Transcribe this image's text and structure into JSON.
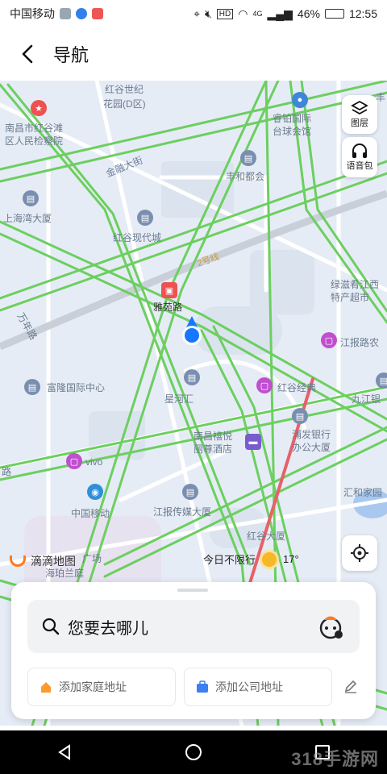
{
  "status_bar": {
    "carrier": "中国移动",
    "battery": "46%",
    "time": "12:55",
    "signal_label": "4G",
    "hd_label": "HD"
  },
  "header": {
    "title": "导航"
  },
  "map": {
    "labels": [
      {
        "text": "红谷世纪"
      },
      {
        "text": "花园(D区)"
      },
      {
        "text": "南昌市红谷滩"
      },
      {
        "text": "区人民检察院"
      },
      {
        "text": "睿铂国际"
      },
      {
        "text": "台球会馆"
      },
      {
        "text": "金融大街"
      },
      {
        "text": "丰和都会"
      },
      {
        "text": "上海湾大厦"
      },
      {
        "text": "红谷现代城"
      },
      {
        "text": "2号线"
      },
      {
        "text": "雅苑路"
      },
      {
        "text": "绿滋肴江西"
      },
      {
        "text": "特产超市"
      },
      {
        "text": "江报路农"
      },
      {
        "text": "万年路"
      },
      {
        "text": "富隆国际中心"
      },
      {
        "text": "星河汇"
      },
      {
        "text": "红谷经典"
      },
      {
        "text": "九江银"
      },
      {
        "text": "浦发银行"
      },
      {
        "text": "办公大厦"
      },
      {
        "text": "南昌禧悦"
      },
      {
        "text": "丽尊酒店"
      },
      {
        "text": "vivo"
      },
      {
        "text": "汇和家园"
      },
      {
        "text": "中国移动"
      },
      {
        "text": "江报传媒大厦"
      },
      {
        "text": "红谷大厦"
      },
      {
        "text": "广场"
      },
      {
        "text": "海珀兰庭"
      },
      {
        "text": "丰"
      },
      {
        "text": "路"
      }
    ],
    "tools": {
      "layers_label": "图层",
      "voice_label": "语音包"
    },
    "brand": "滴滴地图",
    "weather": {
      "text": "今日不限行",
      "temp": "17°"
    }
  },
  "panel": {
    "search_placeholder": "您要去哪儿",
    "home_label": "添加家庭地址",
    "company_label": "添加公司地址"
  },
  "watermark": "318手游网",
  "colors": {
    "map_bg": "#e6ecf6",
    "road_green": "#6ccf5f",
    "road_white": "#ffffff",
    "location_blue": "#1677ff",
    "arrow_red": "#e8606a",
    "brand_orange": "#ff7a1a"
  }
}
